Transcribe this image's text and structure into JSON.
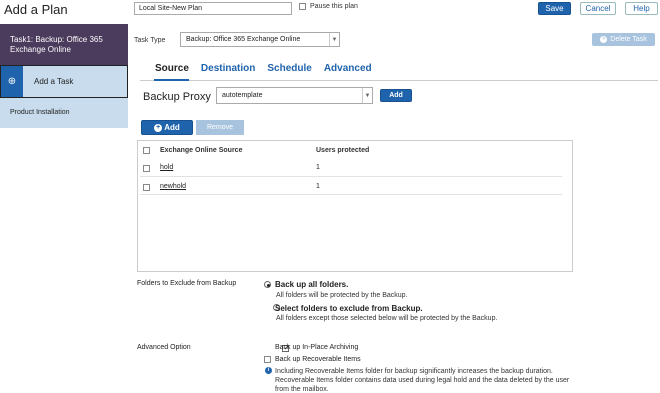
{
  "header": {
    "title": "Add a Plan",
    "plan_name": "Local Site-New Plan",
    "pause_label": "Pause this plan",
    "save_label": "Save",
    "cancel_label": "Cancel",
    "help_label": "Help"
  },
  "sidebar": {
    "task_label": "Task1: Backup: Office 365 Exchange Online",
    "add_task_label": "Add a Task",
    "product_installation_label": "Product Installation"
  },
  "task": {
    "type_label": "Task Type",
    "type_value": "Backup: Office 365 Exchange Online",
    "delete_label": "Delete Task"
  },
  "tabs": [
    {
      "label": "Source"
    },
    {
      "label": "Destination"
    },
    {
      "label": "Schedule"
    },
    {
      "label": "Advanced"
    }
  ],
  "proxy": {
    "label": "Backup Proxy",
    "value": "autotemplate",
    "add_label": "Add"
  },
  "source_table": {
    "add_label": "Add",
    "remove_label": "Remove",
    "columns": [
      "Exchange Online Source",
      "Users protected"
    ],
    "rows": [
      {
        "source": "hold",
        "users": "1"
      },
      {
        "source": "newhold",
        "users": "1"
      }
    ]
  },
  "folders": {
    "label": "Folders to Exclude from Backup",
    "option1_title": "Back up all folders.",
    "option1_desc": "All folders will be protected by the Backup.",
    "option2_title": "Select folders to exclude from Backup.",
    "option2_desc": "All folders except those selected below will be protected by the Backup."
  },
  "advanced_option": {
    "label": "Advanced Option",
    "inplace_label": "Back up In-Place Archiving",
    "recoverable_label": "Back up Recoverable Items",
    "info_text": "Including Recoverable Items folder for backup significantly increases the backup duration. Recoverable Items folder contains data used during legal hold and the data deleted by the user from the mailbox."
  }
}
